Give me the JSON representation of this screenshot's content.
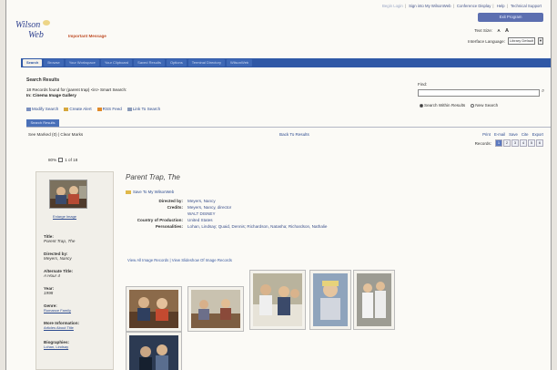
{
  "top_links": {
    "begin": "Begin Login",
    "sign_in": "Sign into My WilsonWeb",
    "conference": "Conference Display",
    "help": "Help",
    "technical": "Technical Support",
    "sticky": "Exit Program",
    "sep": "|"
  },
  "header": {
    "logo_line1": "Wilson",
    "logo_line2": "Web",
    "important": "Important Message",
    "text_size_label": "Text Size:",
    "text_size_a1": "A",
    "text_size_a2": "A",
    "interface_label": "Interface Language:",
    "interface_value": "Library Default",
    "interface_dd": "▼"
  },
  "nav": {
    "tabs": [
      "Search",
      "Browse",
      "Your Workspace",
      "Your Clipboard",
      "Saved Results",
      "Options",
      "Terminal Directory",
      "WilsonWeb"
    ]
  },
  "results": {
    "title": "Search Results",
    "found": "18 Records found for (parent trap) <in> Smart Search:",
    "source": "In: Cinema Image Gallery",
    "modify": "Modify Search",
    "alert": "Create Alert",
    "rss": "RSS Feed",
    "link": "Link To Search",
    "tab": "Search Results"
  },
  "find": {
    "label": "Find:",
    "go": "⌕",
    "opt1": "Search Within Results",
    "opt2": "New Search"
  },
  "toolbar": {
    "marked": "See Marked (0) | Clear Marks",
    "back": "Back To Results",
    "print": "Print",
    "email": "E-mail",
    "save": "Save",
    "cite": "Cite",
    "export": "Export",
    "records_label": "Records:",
    "pages": [
      "1",
      "2",
      "3",
      "4",
      "5",
      "6"
    ]
  },
  "record": {
    "pct": "80%",
    "index": "1 of 18",
    "enlarge": "Enlarge Image",
    "fields": [
      {
        "k": "Title:",
        "v": "Parent Trap, The"
      },
      {
        "k": "Directed by:",
        "v": "Meyers, Nancy"
      },
      {
        "k": "Alternate Title:",
        "v": "A Hour 4"
      },
      {
        "k": "Year:",
        "v": "1998"
      },
      {
        "k": "Genre:",
        "v": "Romance Family",
        "link": true
      },
      {
        "k": "More Information:",
        "v": "Articles About Title",
        "link": true
      },
      {
        "k": "Biographies:",
        "v": "Lohan, Lindsay",
        "link": true
      }
    ],
    "title": "Parent Trap, The",
    "save_link": "Save To My WilsonWeb",
    "meta": [
      {
        "k": "Directed by:",
        "v": "Meyers, Nancy"
      },
      {
        "k": "Credits:",
        "v": "Meyers, Nancy, director"
      },
      {
        "k": "",
        "v": "WALT DISNEY"
      },
      {
        "k": "Country of Production:",
        "v": "United States"
      },
      {
        "k": "Personalities:",
        "v": "Lohan, Lindsay; Quaid, Dennis; Richardson, Natasha; Richardson, Nathalie"
      }
    ],
    "view_links": "View All Image Records | View Slideshow Of Image Records"
  },
  "colors": {
    "nav": "#2f58a6",
    "link": "#2d4b8f",
    "accent": "#c0502a"
  }
}
